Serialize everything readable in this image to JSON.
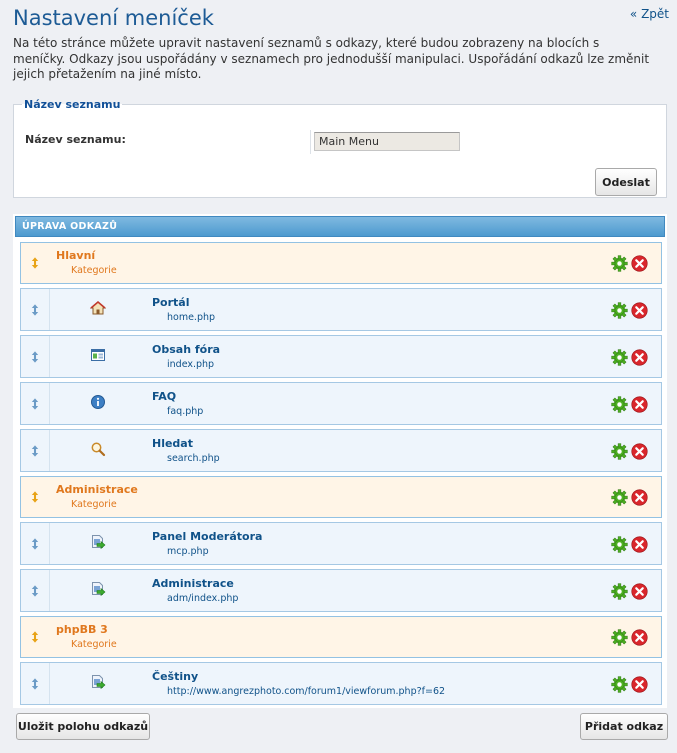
{
  "page": {
    "title": "Nastavení meníček",
    "back_link": "« Zpět",
    "intro": "Na této stránce můžete upravit nastavení seznamů s odkazy, které budou zobrazeny na blocích s meníčky. Odkazy jsou uspořádány v seznamech pro jednodušší manipulaci. Uspořádání odkazů lze změnit jejich přetažením na jiné místo."
  },
  "list_name": {
    "legend": "Název seznamu",
    "label": "Název seznamu:",
    "value": "Main Menu",
    "submit_label": "Odeslat"
  },
  "links": {
    "header": "ÚPRAVA ODKAZŮ",
    "rows": [
      {
        "type": "category",
        "label": "Hlavní",
        "sub": "Kategorie"
      },
      {
        "type": "link",
        "label": "Portál",
        "sub": "home.php",
        "icon": "home-icon"
      },
      {
        "type": "link",
        "label": "Obsah fóra",
        "sub": "index.php",
        "icon": "forum-index-icon"
      },
      {
        "type": "link",
        "label": "FAQ",
        "sub": "faq.php",
        "icon": "info-icon"
      },
      {
        "type": "link",
        "label": "Hledat",
        "sub": "search.php",
        "icon": "search-icon"
      },
      {
        "type": "category",
        "label": "Administrace",
        "sub": "Kategorie"
      },
      {
        "type": "link",
        "label": "Panel Moderátora",
        "sub": "mcp.php",
        "icon": "go-arrow-icon"
      },
      {
        "type": "link",
        "label": "Administrace",
        "sub": "adm/index.php",
        "icon": "go-arrow-icon"
      },
      {
        "type": "category",
        "label": "phpBB 3",
        "sub": "Kategorie"
      },
      {
        "type": "link",
        "label": "Češtiny",
        "sub": "http://www.angrezphoto.com/forum1/viewforum.php?f=62",
        "icon": "go-arrow-icon"
      }
    ]
  },
  "footer": {
    "save_label": "Uložit polohu odkazů",
    "add_label": "Přidat odkaz"
  },
  "colors": {
    "title": "#1d5b95",
    "category_text": "#e0781e",
    "link_text": "#105289",
    "header_bg": "#5aa2d6",
    "edit_icon": "#4caf21",
    "delete_icon": "#d9262c"
  }
}
